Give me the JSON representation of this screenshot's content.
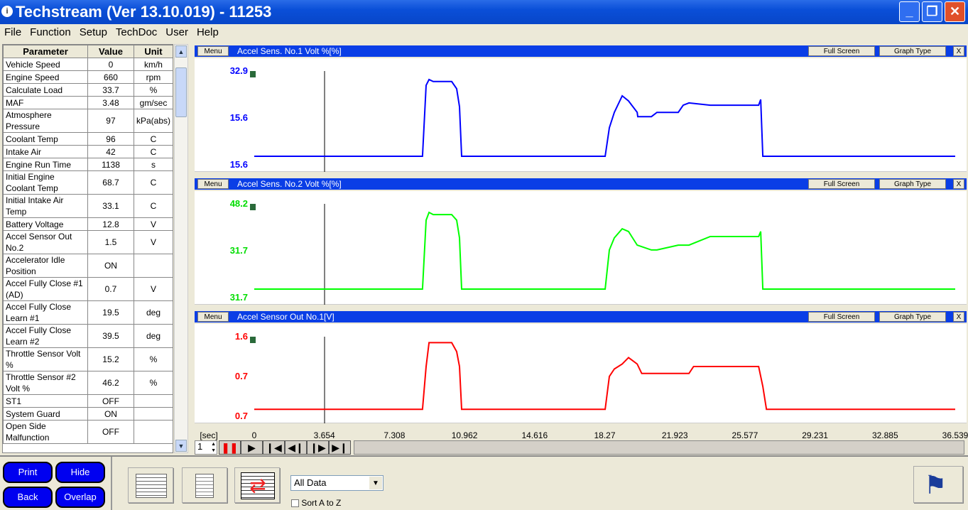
{
  "window": {
    "title": "Techstream (Ver 13.10.019) - 11253",
    "minimize": "_",
    "restore": "❐",
    "close": "✕"
  },
  "menu": [
    "File",
    "Function",
    "Setup",
    "TechDoc",
    "User",
    "Help"
  ],
  "table": {
    "headers": [
      "Parameter",
      "Value",
      "Unit"
    ],
    "rows": [
      [
        "Vehicle Speed",
        "0",
        "km/h"
      ],
      [
        "Engine Speed",
        "660",
        "rpm"
      ],
      [
        "Calculate Load",
        "33.7",
        "%"
      ],
      [
        "MAF",
        "3.48",
        "gm/sec"
      ],
      [
        "Atmosphere Pressure",
        "97",
        "kPa(abs)"
      ],
      [
        "Coolant Temp",
        "96",
        "C"
      ],
      [
        "Intake Air",
        "42",
        "C"
      ],
      [
        "Engine Run Time",
        "1138",
        "s"
      ],
      [
        "Initial Engine Coolant Temp",
        "68.7",
        "C"
      ],
      [
        "Initial Intake Air Temp",
        "33.1",
        "C"
      ],
      [
        "Battery Voltage",
        "12.8",
        "V"
      ],
      [
        "Accel Sensor Out No.2",
        "1.5",
        "V"
      ],
      [
        "Accelerator Idle Position",
        "ON",
        ""
      ],
      [
        "Accel Fully Close #1 (AD)",
        "0.7",
        "V"
      ],
      [
        "Accel Fully Close Learn #1",
        "19.5",
        "deg"
      ],
      [
        "Accel Fully Close Learn #2",
        "39.5",
        "deg"
      ],
      [
        "Throttle Sensor Volt %",
        "15.2",
        "%"
      ],
      [
        "Throttle Sensor #2 Volt %",
        "46.2",
        "%"
      ],
      [
        "ST1",
        "OFF",
        ""
      ],
      [
        "System Guard",
        "ON",
        ""
      ],
      [
        "Open Side Malfunction",
        "OFF",
        ""
      ]
    ]
  },
  "panel_buttons": {
    "menu": "Menu",
    "full_screen": "Full Screen",
    "graph_type": "Graph Type",
    "close": "X"
  },
  "chart_data": [
    {
      "type": "line",
      "title": "Accel Sens. No.1 Volt %[%]",
      "color": "#0000ff",
      "yticks": [
        "32.9",
        "15.6",
        "15.6"
      ],
      "ylim": [
        0,
        32.9
      ],
      "xlim": [
        0,
        36.539
      ],
      "points": [
        [
          0,
          3.0
        ],
        [
          8.77,
          3.0
        ],
        [
          8.96,
          27.9
        ],
        [
          9.11,
          29.9
        ],
        [
          9.33,
          29.2
        ],
        [
          10.29,
          29.2
        ],
        [
          10.55,
          26.7
        ],
        [
          10.7,
          20.4
        ],
        [
          10.81,
          3.0
        ],
        [
          18.29,
          3.0
        ],
        [
          18.51,
          13.0
        ],
        [
          18.77,
          18.4
        ],
        [
          19.18,
          24.2
        ],
        [
          19.51,
          22.4
        ],
        [
          19.96,
          18.4
        ],
        [
          19.99,
          16.9
        ],
        [
          20.7,
          16.9
        ],
        [
          20.99,
          18.4
        ],
        [
          22.1,
          18.4
        ],
        [
          22.36,
          20.9
        ],
        [
          22.66,
          21.7
        ],
        [
          23.77,
          20.9
        ],
        [
          26.29,
          20.9
        ],
        [
          26.4,
          22.9
        ],
        [
          26.51,
          3.0
        ],
        [
          36.539,
          3.0
        ]
      ]
    },
    {
      "type": "line",
      "title": "Accel Sens. No.2 Volt %[%]",
      "color": "#00ff00",
      "yticks": [
        "48.2",
        "31.7",
        "31.7"
      ],
      "ylim": [
        0,
        48.2
      ],
      "xlim": [
        0,
        36.539
      ],
      "points": [
        [
          0,
          4.4
        ],
        [
          8.77,
          4.4
        ],
        [
          8.96,
          39.8
        ],
        [
          9.11,
          43.8
        ],
        [
          9.33,
          42.7
        ],
        [
          10.29,
          42.7
        ],
        [
          10.55,
          39.8
        ],
        [
          10.7,
          30.7
        ],
        [
          10.81,
          4.4
        ],
        [
          18.29,
          4.4
        ],
        [
          18.51,
          24.5
        ],
        [
          18.77,
          30.7
        ],
        [
          19.18,
          35.4
        ],
        [
          19.51,
          34.0
        ],
        [
          19.96,
          27.0
        ],
        [
          20.7,
          24.5
        ],
        [
          20.99,
          24.5
        ],
        [
          22.1,
          27.0
        ],
        [
          22.66,
          27.0
        ],
        [
          23.77,
          31.4
        ],
        [
          26.29,
          31.4
        ],
        [
          26.4,
          34.0
        ],
        [
          26.51,
          4.4
        ],
        [
          36.539,
          4.4
        ]
      ]
    },
    {
      "type": "line",
      "title": "Accel Sensor Out No.1[V]",
      "color": "#ff0000",
      "yticks": [
        "1.6",
        "0.7",
        "0.7"
      ],
      "ylim": [
        0,
        1.6
      ],
      "xlim": [
        0,
        36.539
      ],
      "points": [
        [
          0,
          0.14
        ],
        [
          8.77,
          0.14
        ],
        [
          8.96,
          1.0
        ],
        [
          9.11,
          1.48
        ],
        [
          10.29,
          1.48
        ],
        [
          10.55,
          1.3
        ],
        [
          10.7,
          1.0
        ],
        [
          10.81,
          0.14
        ],
        [
          18.29,
          0.14
        ],
        [
          18.51,
          0.8
        ],
        [
          18.77,
          0.95
        ],
        [
          19.18,
          1.05
        ],
        [
          19.51,
          1.18
        ],
        [
          19.96,
          1.05
        ],
        [
          20.2,
          0.86
        ],
        [
          22.36,
          0.86
        ],
        [
          22.66,
          0.86
        ],
        [
          22.9,
          1.0
        ],
        [
          26.29,
          1.0
        ],
        [
          26.51,
          0.6
        ],
        [
          26.7,
          0.14
        ],
        [
          36.539,
          0.14
        ]
      ]
    }
  ],
  "time_axis": {
    "unit": "[sec]",
    "ticks": [
      "0",
      "3.654",
      "7.308",
      "10.962",
      "14.616",
      "18.27",
      "21.923",
      "25.577",
      "29.231",
      "32.885",
      "36.539"
    ]
  },
  "controls": {
    "speed": "1"
  },
  "bottom": {
    "print": "Print",
    "hide": "Hide",
    "back": "Back",
    "overlap": "Overlap",
    "dropdown": "All Data",
    "sort": "Sort A to Z"
  }
}
